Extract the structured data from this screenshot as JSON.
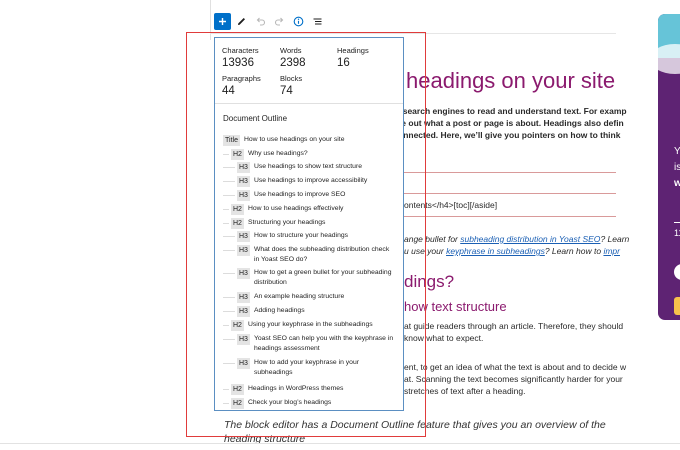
{
  "document": {
    "heading_big": "headings on your site",
    "intro_lines": [
      "l search engines to read and understand text. For examp",
      "re out what a post or page is about. Headings also defin",
      "onnected. Here, we’ll give you pointers on how to think"
    ],
    "shortcode_text": "ontents</h4>[toc][/aside]",
    "italic_line1_prefix": "ange bullet for ",
    "italic_line1_link": "subheading distribution in Yoast SEO",
    "italic_line1_suffix": "? Learn",
    "italic_line2_prefix": "u use your ",
    "italic_line2_link": "keyphrase in subheadings",
    "italic_line2_suffix": "? Learn how to ",
    "italic_line2_tail": "impr",
    "h2_partial": "dings?",
    "h3_partial": "how text structure",
    "para_lines": [
      "at guide readers through an article. Therefore, they should",
      "know what to expect.",
      "",
      "ent, to get an idea of what the text is about and to decide w",
      "at. Scanning the text becomes significantly harder for your",
      "stretches of text after a heading."
    ],
    "bottom_italic": "The block editor has a Document Outline feature that gives you an overview of the",
    "bottom_italic_2": "heading structure"
  },
  "card": {
    "line1": "Y",
    "line2": "is",
    "line3": "w",
    "line4": "11"
  },
  "stats": {
    "characters_label": "Characters",
    "characters_value": "13936",
    "words_label": "Words",
    "words_value": "2398",
    "headings_label": "Headings",
    "headings_value": "16",
    "paragraphs_label": "Paragraphs",
    "paragraphs_value": "44",
    "blocks_label": "Blocks",
    "blocks_value": "74"
  },
  "outline": {
    "title": "Document Outline",
    "items": [
      {
        "level": "Title",
        "text": "How to use headings on your site"
      },
      {
        "level": "H2",
        "text": "Why use headings?"
      },
      {
        "level": "H3",
        "text": "Use headings to show text structure"
      },
      {
        "level": "H3",
        "text": "Use headings to improve accessibility"
      },
      {
        "level": "H3",
        "text": "Use headings to improve SEO"
      },
      {
        "level": "H2",
        "text": "How to use headings effectively"
      },
      {
        "level": "H2",
        "text": "Structuring your headings"
      },
      {
        "level": "H3",
        "text": "How to structure your headings"
      },
      {
        "level": "H3",
        "text": "What does the subheading distribution check in Yoast SEO do?"
      },
      {
        "level": "H3",
        "text": "How to get a green bullet for your subheading distribution"
      },
      {
        "level": "H3",
        "text": "An example heading structure"
      },
      {
        "level": "H3",
        "text": "Adding headings"
      },
      {
        "level": "H2",
        "text": "Using your keyphrase in the subheadings"
      },
      {
        "level": "H3",
        "text": "Yoast SEO can help you with the keyphrase in headings assessment"
      },
      {
        "level": "H3",
        "text": "How to add your keyphrase in your subheadings"
      },
      {
        "level": "H2",
        "text": "Headings in WordPress themes"
      },
      {
        "level": "H2",
        "text": "Check your blog’s headings"
      }
    ]
  },
  "toolbar": {
    "add_icon": "plus-icon",
    "tools_icon": "pen-icon",
    "undo_icon": "undo-icon",
    "redo_icon": "redo-icon",
    "details_icon": "info-icon",
    "list_view_icon": "list-view-icon"
  },
  "colors": {
    "heading": "#8b1a6e",
    "accent": "#0070c9",
    "annotation": "#e03b3b",
    "card": "#5e2373"
  }
}
